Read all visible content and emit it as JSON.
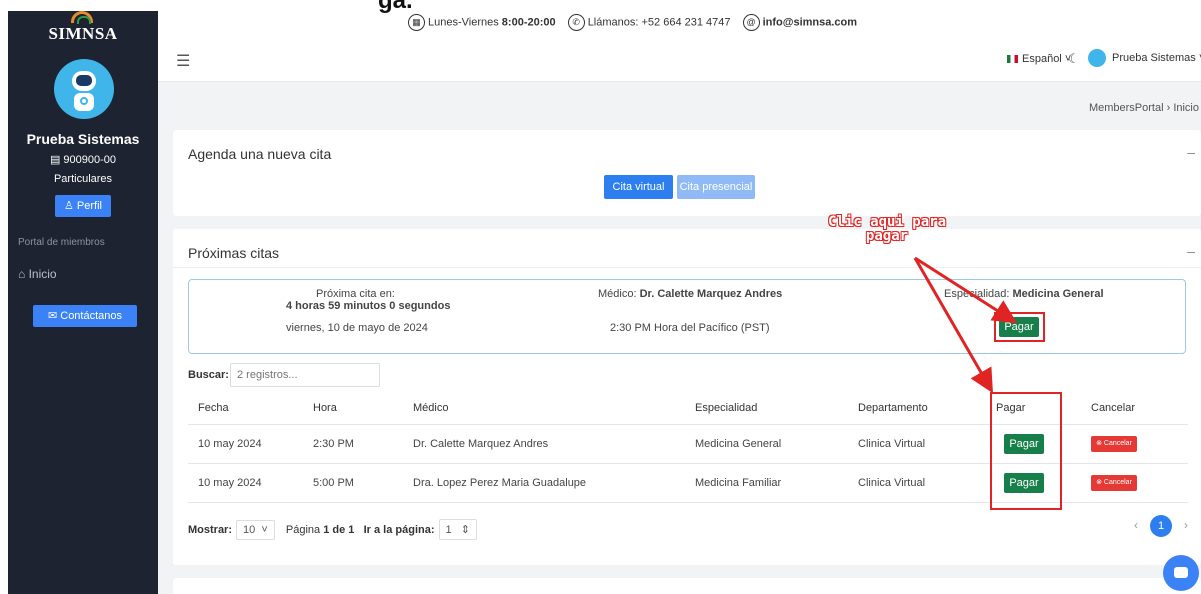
{
  "sidebar": {
    "brand": "SIMNSA",
    "user_name": "Prueba Sistemas",
    "member_id": "900900-00",
    "plan": "Particulares",
    "profile_button": "Perfil",
    "section_label": "Portal de miembros",
    "nav_home": "Inicio",
    "contact_button": "Contáctanos"
  },
  "topbar": {
    "hours_label": "Lunes-Viernes",
    "hours_value": "8:00-20:00",
    "phone": "Llámanos: +52 664 231 4747",
    "email": "info@simnsa.com",
    "language": "Español",
    "user": "Prueba Sistemas",
    "heading_fragment": "ga."
  },
  "breadcrumb": {
    "root": "MembersPortal",
    "current": "Inicio"
  },
  "new_appointment": {
    "title": "Agenda una nueva cita",
    "virtual_button": "Cita virtual",
    "in_person_button": "Cita presencial",
    "collapse": "–"
  },
  "upcoming": {
    "title": "Próximas citas",
    "collapse": "–",
    "next": {
      "countdown_label": "Próxima cita en:",
      "countdown": "4 horas 59 minutos 0 segundos",
      "date": "viernes, 10 de mayo de 2024",
      "doctor_label": "Médico:",
      "doctor": "Dr. Calette Marquez Andres",
      "time": "2:30 PM Hora del Pacífico (PST)",
      "specialty_label": "Especialidad:",
      "specialty": "Medicina General",
      "pay_button": "Pagar"
    },
    "search_label": "Buscar:",
    "search_placeholder": "2 registros...",
    "columns": [
      "Fecha",
      "Hora",
      "Médico",
      "Especialidad",
      "Departamento",
      "Pagar",
      "Cancelar"
    ],
    "rows": [
      {
        "date": "10 may 2024",
        "time": "2:30 PM",
        "doctor": "Dr. Calette Marquez Andres",
        "specialty": "Medicina General",
        "department": "Clinica Virtual",
        "pay": "Pagar",
        "cancel": "Cancelar"
      },
      {
        "date": "10 may 2024",
        "time": "5:00 PM",
        "doctor": "Dra. Lopez Perez Maria Guadalupe",
        "specialty": "Medicina Familiar",
        "department": "Clinica Virtual",
        "pay": "Pagar",
        "cancel": "Cancelar"
      }
    ],
    "show_label": "Mostrar:",
    "page_size": "10",
    "page_info_prefix": "Página",
    "page_current": "1",
    "page_info_middle": "de",
    "page_total": "1",
    "goto_label": "Ir a la página:",
    "goto_value": "1",
    "pager_current": "1"
  },
  "annotation": {
    "line1": "Clic aqui para",
    "line2": "pagar",
    "color": "#e02424"
  },
  "colors": {
    "sidebar_bg": "#1d2330",
    "primary": "#2d7ff0",
    "pay_green": "#17804a",
    "cancel_red": "#e53935"
  }
}
